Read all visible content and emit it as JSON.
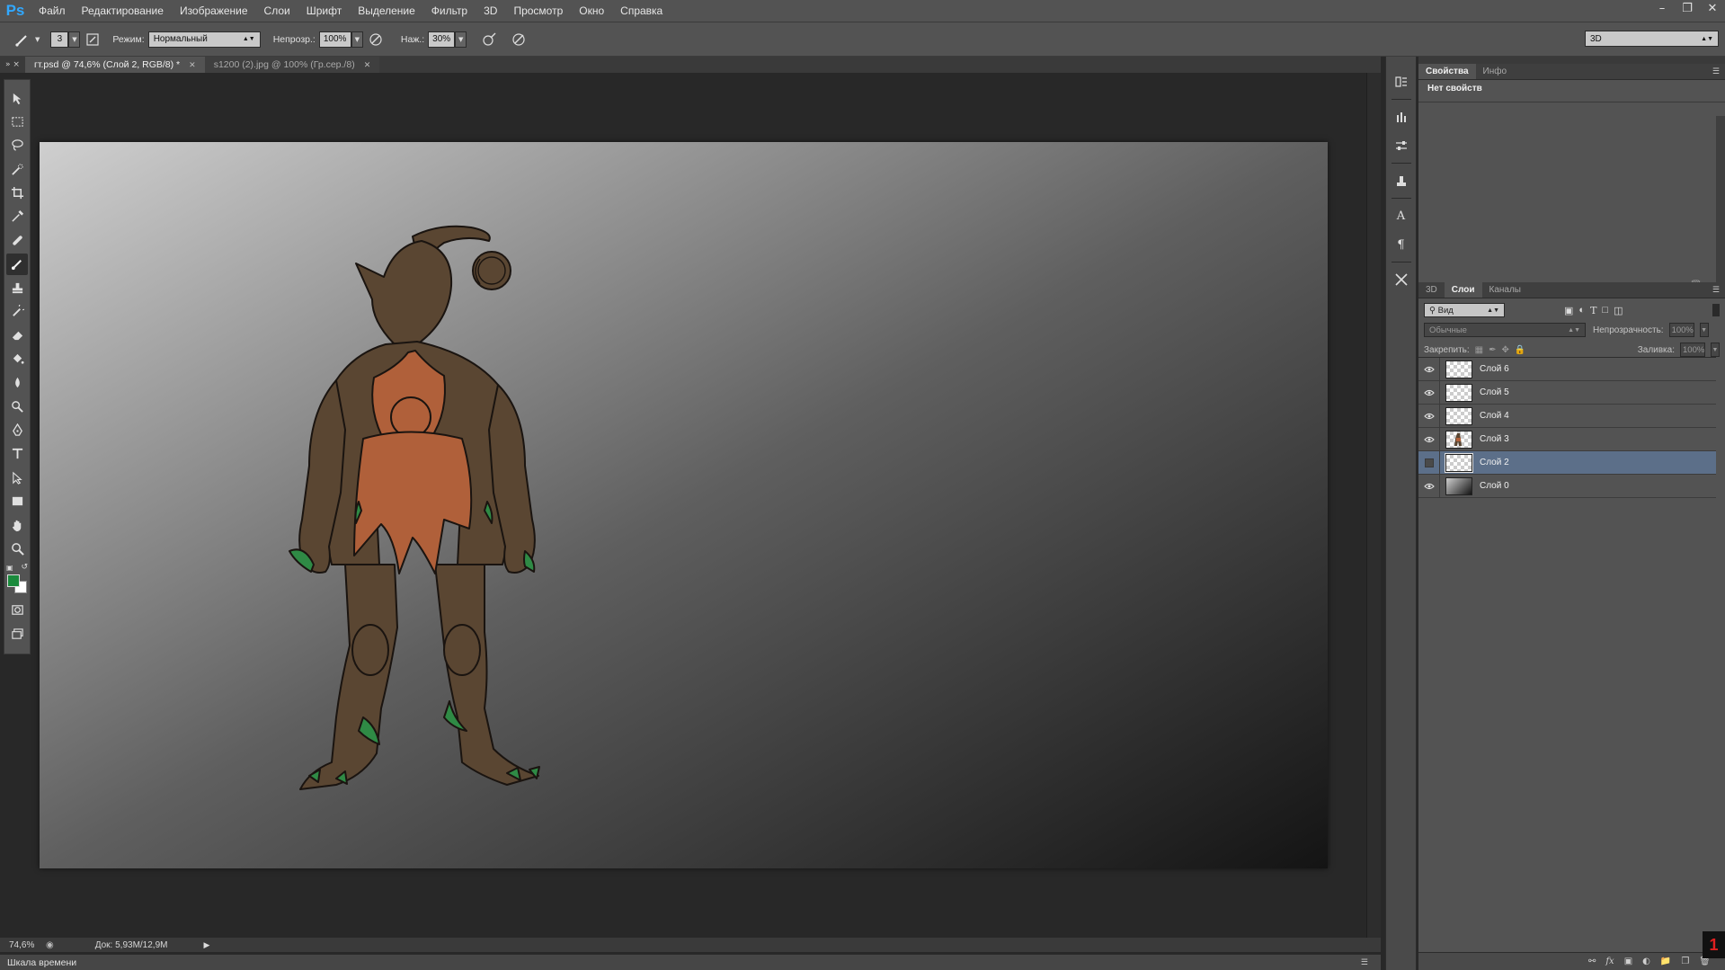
{
  "app": {
    "logo": "Ps"
  },
  "menu": [
    "Файл",
    "Редактирование",
    "Изображение",
    "Слои",
    "Шрифт",
    "Выделение",
    "Фильтр",
    "3D",
    "Просмотр",
    "Окно",
    "Справка"
  ],
  "options": {
    "brush_size": "3",
    "mode_label": "Режим:",
    "mode_value": "Нормальный",
    "opacity_label": "Непрозр.:",
    "opacity_value": "100%",
    "pressure_label": "Наж.:",
    "pressure_value": "30%",
    "workspace": "3D"
  },
  "tabs": [
    {
      "label": "гт.psd @ 74,6% (Слой 2, RGB/8) *",
      "active": true
    },
    {
      "label": "s1200 (2).jpg @ 100% (Гр.сер./8)",
      "active": false
    }
  ],
  "status": {
    "zoom": "74,6%",
    "doc": "Док: 5,93M/12,9M"
  },
  "timeline": "Шкала времени",
  "properties": {
    "tabs": [
      "Свойства",
      "Инфо"
    ],
    "empty_text": "Нет свойств"
  },
  "layers_panel": {
    "tabs": [
      "3D",
      "Слои",
      "Каналы"
    ],
    "filter_kind": "Вид",
    "blend_mode": "Обычные",
    "opacity_label": "Непрозрачность:",
    "opacity_value": "100%",
    "lock_label": "Закрепить:",
    "fill_label": "Заливка:",
    "fill_value": "100%",
    "layers": [
      {
        "name": "Слой 6",
        "visible": true,
        "selected": false,
        "thumb": "transparent"
      },
      {
        "name": "Слой 5",
        "visible": true,
        "selected": false,
        "thumb": "transparent"
      },
      {
        "name": "Слой 4",
        "visible": true,
        "selected": false,
        "thumb": "transparent"
      },
      {
        "name": "Слой 3",
        "visible": true,
        "selected": false,
        "thumb": "figure"
      },
      {
        "name": "Слой 2",
        "visible": false,
        "selected": true,
        "thumb": "transparent"
      },
      {
        "name": "Слой 0",
        "visible": true,
        "selected": false,
        "thumb": "gradient"
      }
    ]
  },
  "colors": {
    "foreground": "#1a8a3c",
    "background": "#ffffff",
    "selection": "#5c6f89"
  },
  "corner_badge": "1"
}
